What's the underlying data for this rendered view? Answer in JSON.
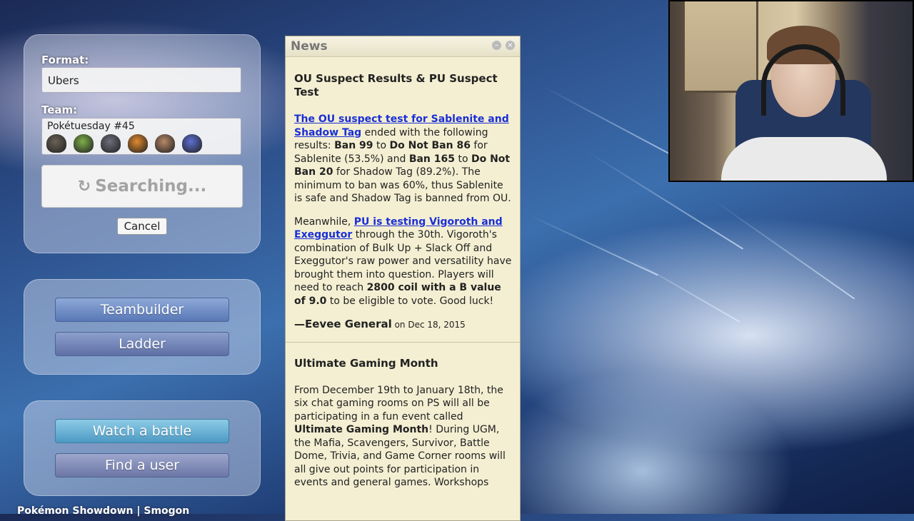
{
  "start_panel": {
    "format_label": "Format:",
    "format_value": "Ubers",
    "team_label": "Team:",
    "team_name": "Pokétuesday #45",
    "team_sprites": [
      "#6b6257",
      "#7fb04a",
      "#6e6e7c",
      "#e38a2e",
      "#b98866",
      "#5c6fd4"
    ],
    "search_label": "Searching...",
    "cancel_label": "Cancel"
  },
  "menu": {
    "teambuilder": "Teambuilder",
    "ladder": "Ladder",
    "watch_battle": "Watch a battle",
    "find_user": "Find a user"
  },
  "footer": {
    "text": "Pokémon Showdown | Smogon"
  },
  "news": {
    "title": "News",
    "item1": {
      "headline": "OU Suspect Results & PU Suspect Test",
      "p1_link": "The OU suspect test for Sablenite and Shadow Tag",
      "p1_t1": " ended with the following results: ",
      "p1_b1": "Ban 99",
      "p1_t2": " to ",
      "p1_b2": "Do Not Ban 86",
      "p1_t3": " for Sablenite (53.5%) and ",
      "p1_b3": "Ban 165",
      "p1_t4": " to ",
      "p1_b4": "Do Not Ban 20",
      "p1_t5": " for Shadow Tag (89.2%). The minimum to ban was 60%, thus Sablenite is safe and Shadow Tag is banned from OU.",
      "p2_t1": "Meanwhile, ",
      "p2_link": "PU is testing Vigoroth and Exeggutor",
      "p2_t2": " through the 30th. Vigoroth's combination of Bulk Up + Slack Off and Exeggutor's raw power and versatility have brought them into question. Players will need to reach ",
      "p2_b1": "2800 coil with a B value of 9.0",
      "p2_t3": " to be eligible to vote. Good luck!",
      "author": "—Eevee General",
      "date": " on Dec 18, 2015"
    },
    "item2": {
      "headline": "Ultimate Gaming Month",
      "p1_t1": "From December 19th to January 18th, the six chat gaming rooms on PS will all be participating in a fun event called ",
      "p1_b1": "Ultimate Gaming Month",
      "p1_t2": "! During UGM, the Mafia, Scavengers, Survivor, Battle Dome, Trivia, and Game Corner rooms will all give out points for participation in events and general games. Workshops"
    },
    "minimize_glyph": "–",
    "close_glyph": "×"
  },
  "icons": {
    "spinner": "↻"
  }
}
